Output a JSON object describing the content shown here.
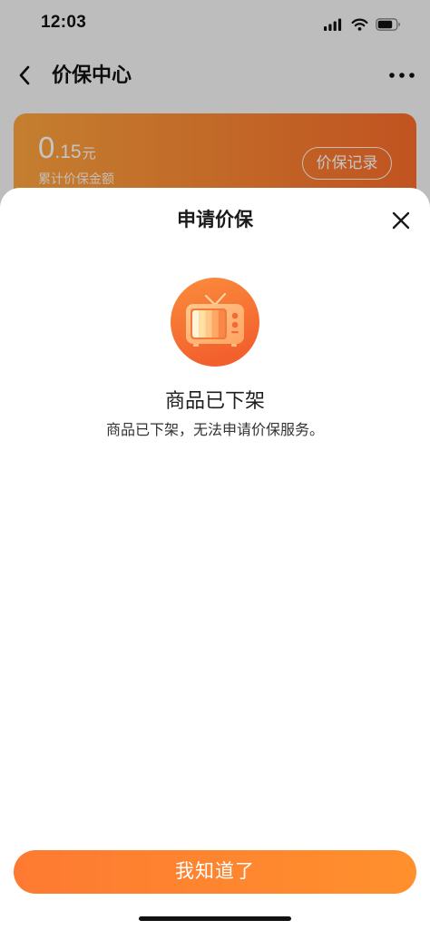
{
  "status_bar": {
    "time": "12:03",
    "icons": [
      "signal-icon",
      "wifi-icon",
      "battery-icon"
    ]
  },
  "nav": {
    "title": "价保中心",
    "back_icon": "chevron-left-icon",
    "more_icon": "more-dots-icon"
  },
  "summary_card": {
    "amount_int": "0",
    "amount_dec": ".15",
    "amount_unit": "元",
    "label": "累计价保金额",
    "record_button": "价保记录"
  },
  "dialog": {
    "title": "申请价保",
    "close_icon": "close-icon",
    "illustration": "tv-icon",
    "heading": "商品已下架",
    "message": "商品已下架，无法申请价保服务。",
    "confirm_button": "我知道了"
  },
  "colors": {
    "card_start": "#ffa53e",
    "card_end": "#fb6d2b",
    "button_start": "#fe7a32",
    "button_end": "#ff902d"
  }
}
